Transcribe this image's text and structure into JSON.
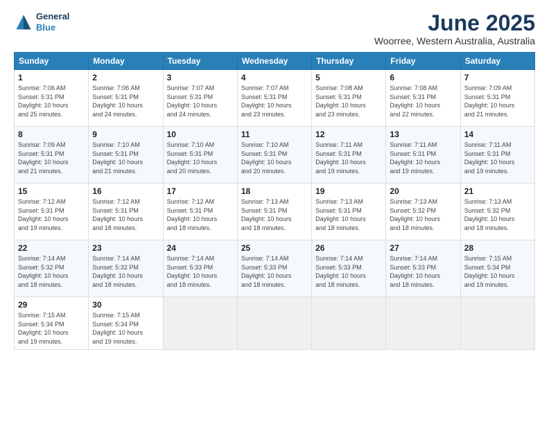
{
  "header": {
    "logo": {
      "line1": "General",
      "line2": "Blue"
    },
    "title": "June 2025",
    "location": "Woorree, Western Australia, Australia"
  },
  "weekdays": [
    "Sunday",
    "Monday",
    "Tuesday",
    "Wednesday",
    "Thursday",
    "Friday",
    "Saturday"
  ],
  "weeks": [
    [
      {
        "day": "1",
        "info": "Sunrise: 7:06 AM\nSunset: 5:31 PM\nDaylight: 10 hours\nand 25 minutes."
      },
      {
        "day": "2",
        "info": "Sunrise: 7:06 AM\nSunset: 5:31 PM\nDaylight: 10 hours\nand 24 minutes."
      },
      {
        "day": "3",
        "info": "Sunrise: 7:07 AM\nSunset: 5:31 PM\nDaylight: 10 hours\nand 24 minutes."
      },
      {
        "day": "4",
        "info": "Sunrise: 7:07 AM\nSunset: 5:31 PM\nDaylight: 10 hours\nand 23 minutes."
      },
      {
        "day": "5",
        "info": "Sunrise: 7:08 AM\nSunset: 5:31 PM\nDaylight: 10 hours\nand 23 minutes."
      },
      {
        "day": "6",
        "info": "Sunrise: 7:08 AM\nSunset: 5:31 PM\nDaylight: 10 hours\nand 22 minutes."
      },
      {
        "day": "7",
        "info": "Sunrise: 7:09 AM\nSunset: 5:31 PM\nDaylight: 10 hours\nand 21 minutes."
      }
    ],
    [
      {
        "day": "8",
        "info": "Sunrise: 7:09 AM\nSunset: 5:31 PM\nDaylight: 10 hours\nand 21 minutes."
      },
      {
        "day": "9",
        "info": "Sunrise: 7:10 AM\nSunset: 5:31 PM\nDaylight: 10 hours\nand 21 minutes."
      },
      {
        "day": "10",
        "info": "Sunrise: 7:10 AM\nSunset: 5:31 PM\nDaylight: 10 hours\nand 20 minutes."
      },
      {
        "day": "11",
        "info": "Sunrise: 7:10 AM\nSunset: 5:31 PM\nDaylight: 10 hours\nand 20 minutes."
      },
      {
        "day": "12",
        "info": "Sunrise: 7:11 AM\nSunset: 5:31 PM\nDaylight: 10 hours\nand 19 minutes."
      },
      {
        "day": "13",
        "info": "Sunrise: 7:11 AM\nSunset: 5:31 PM\nDaylight: 10 hours\nand 19 minutes."
      },
      {
        "day": "14",
        "info": "Sunrise: 7:11 AM\nSunset: 5:31 PM\nDaylight: 10 hours\nand 19 minutes."
      }
    ],
    [
      {
        "day": "15",
        "info": "Sunrise: 7:12 AM\nSunset: 5:31 PM\nDaylight: 10 hours\nand 19 minutes."
      },
      {
        "day": "16",
        "info": "Sunrise: 7:12 AM\nSunset: 5:31 PM\nDaylight: 10 hours\nand 18 minutes."
      },
      {
        "day": "17",
        "info": "Sunrise: 7:12 AM\nSunset: 5:31 PM\nDaylight: 10 hours\nand 18 minutes."
      },
      {
        "day": "18",
        "info": "Sunrise: 7:13 AM\nSunset: 5:31 PM\nDaylight: 10 hours\nand 18 minutes."
      },
      {
        "day": "19",
        "info": "Sunrise: 7:13 AM\nSunset: 5:31 PM\nDaylight: 10 hours\nand 18 minutes."
      },
      {
        "day": "20",
        "info": "Sunrise: 7:13 AM\nSunset: 5:32 PM\nDaylight: 10 hours\nand 18 minutes."
      },
      {
        "day": "21",
        "info": "Sunrise: 7:13 AM\nSunset: 5:32 PM\nDaylight: 10 hours\nand 18 minutes."
      }
    ],
    [
      {
        "day": "22",
        "info": "Sunrise: 7:14 AM\nSunset: 5:32 PM\nDaylight: 10 hours\nand 18 minutes."
      },
      {
        "day": "23",
        "info": "Sunrise: 7:14 AM\nSunset: 5:32 PM\nDaylight: 10 hours\nand 18 minutes."
      },
      {
        "day": "24",
        "info": "Sunrise: 7:14 AM\nSunset: 5:33 PM\nDaylight: 10 hours\nand 18 minutes."
      },
      {
        "day": "25",
        "info": "Sunrise: 7:14 AM\nSunset: 5:33 PM\nDaylight: 10 hours\nand 18 minutes."
      },
      {
        "day": "26",
        "info": "Sunrise: 7:14 AM\nSunset: 5:33 PM\nDaylight: 10 hours\nand 18 minutes."
      },
      {
        "day": "27",
        "info": "Sunrise: 7:14 AM\nSunset: 5:33 PM\nDaylight: 10 hours\nand 18 minutes."
      },
      {
        "day": "28",
        "info": "Sunrise: 7:15 AM\nSunset: 5:34 PM\nDaylight: 10 hours\nand 19 minutes."
      }
    ],
    [
      {
        "day": "29",
        "info": "Sunrise: 7:15 AM\nSunset: 5:34 PM\nDaylight: 10 hours\nand 19 minutes."
      },
      {
        "day": "30",
        "info": "Sunrise: 7:15 AM\nSunset: 5:34 PM\nDaylight: 10 hours\nand 19 minutes."
      },
      {
        "day": "",
        "info": ""
      },
      {
        "day": "",
        "info": ""
      },
      {
        "day": "",
        "info": ""
      },
      {
        "day": "",
        "info": ""
      },
      {
        "day": "",
        "info": ""
      }
    ]
  ]
}
